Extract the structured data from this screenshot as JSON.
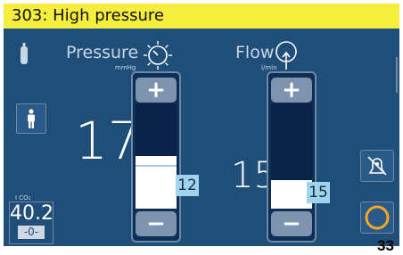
{
  "alarm": {
    "text": "303: High pressure"
  },
  "pressure": {
    "label": "Pressure",
    "unit": "mmHg",
    "current": "17",
    "setpoint": "12",
    "fill_fraction": 0.5
  },
  "flow": {
    "label": "Flow",
    "unit": "l/min",
    "current": "15",
    "setpoint": "15",
    "fill_fraction": 0.27
  },
  "co2": {
    "label": "I CO₂",
    "value": "40.2",
    "sub": "-0-"
  },
  "figure_number": "33",
  "icons": [
    "gas-cylinder-icon",
    "pressure-dial-icon",
    "flow-icon",
    "patient-icon",
    "alarm-silence-icon",
    "power-ring-icon"
  ],
  "colors": {
    "screen_bg": "#1f4e79",
    "alarm_bar": "#f5ee3f",
    "badge": "#9fd4ef",
    "ring": "#f5a623"
  }
}
